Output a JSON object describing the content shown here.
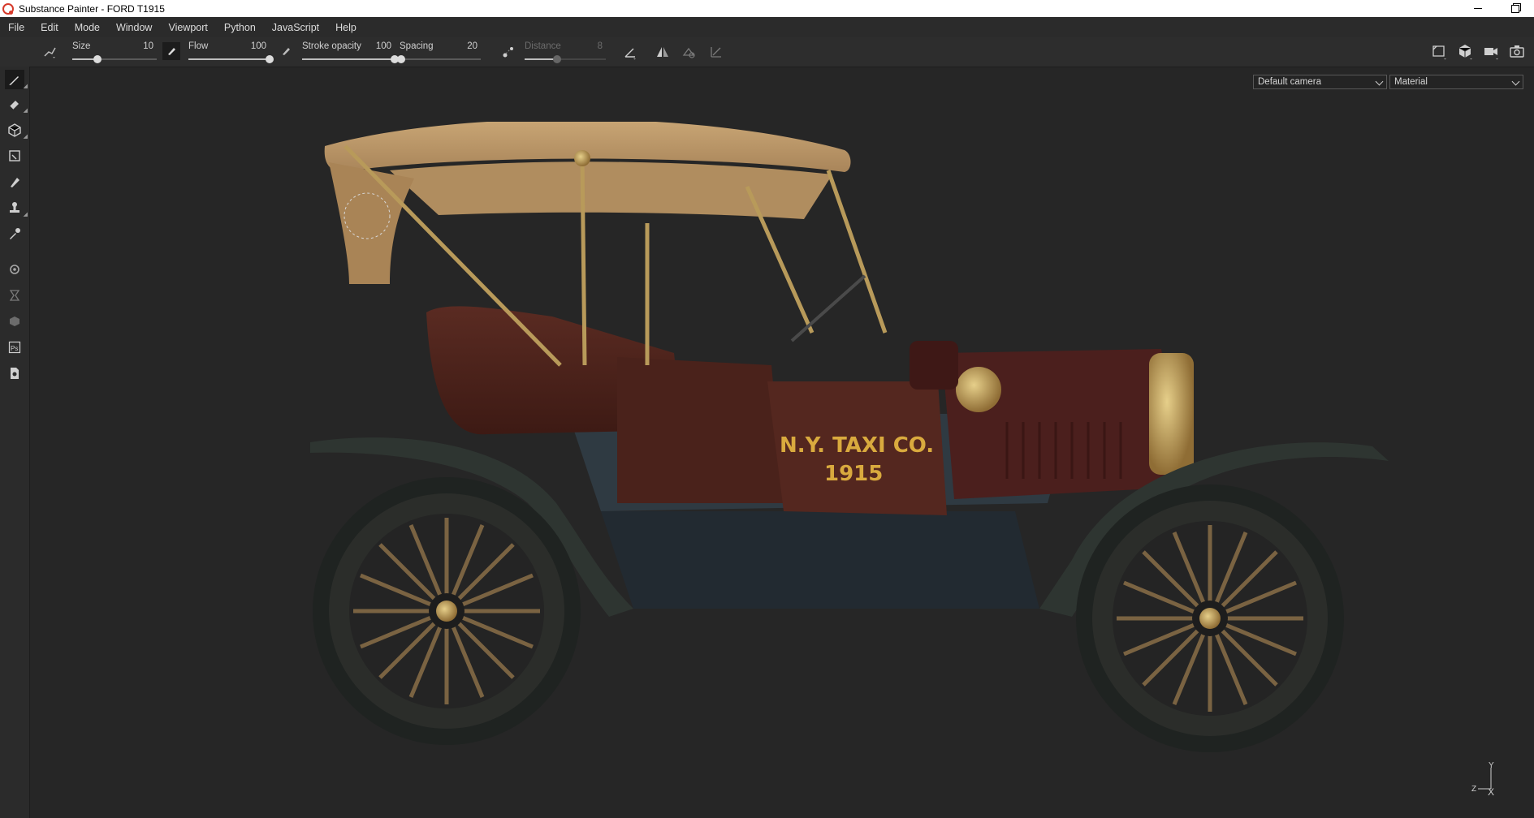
{
  "window": {
    "title": "Substance Painter - FORD T1915"
  },
  "menu": [
    "File",
    "Edit",
    "Mode",
    "Window",
    "Viewport",
    "Python",
    "JavaScript",
    "Help"
  ],
  "tool_params": {
    "size": {
      "label": "Size",
      "value": "10",
      "fraction": 0.3
    },
    "flow": {
      "label": "Flow",
      "value": "100",
      "fraction": 1.0
    },
    "stroke_opacity": {
      "label": "Stroke opacity",
      "value": "100",
      "fraction": 1.0
    },
    "spacing": {
      "label": "Spacing",
      "value": "20",
      "fraction": 0.02
    },
    "distance": {
      "label": "Distance",
      "value": "8",
      "fraction": 0.4,
      "enabled": false
    }
  },
  "viewport": {
    "camera_select": "Default camera",
    "mode_select": "Material",
    "decal_line1": "N.Y. TAXI CO.",
    "decal_line2": "1915",
    "axis": {
      "y": "Y",
      "z": "Z",
      "x": "X"
    }
  },
  "left_tools": [
    "paint-brush-icon",
    "eraser-icon",
    "projection-icon",
    "polygon-fill-icon",
    "smudge-icon",
    "clone-icon",
    "color-picker-icon",
    "bake-settings-icon",
    "history-icon",
    "plugin-icon",
    "photoshop-export-icon",
    "export-icon"
  ],
  "colors": {
    "accent": "#d63a2b",
    "decal": "#d9aa3e",
    "viewport_bg": "#262626",
    "panel_bg": "#2b2b2b"
  }
}
